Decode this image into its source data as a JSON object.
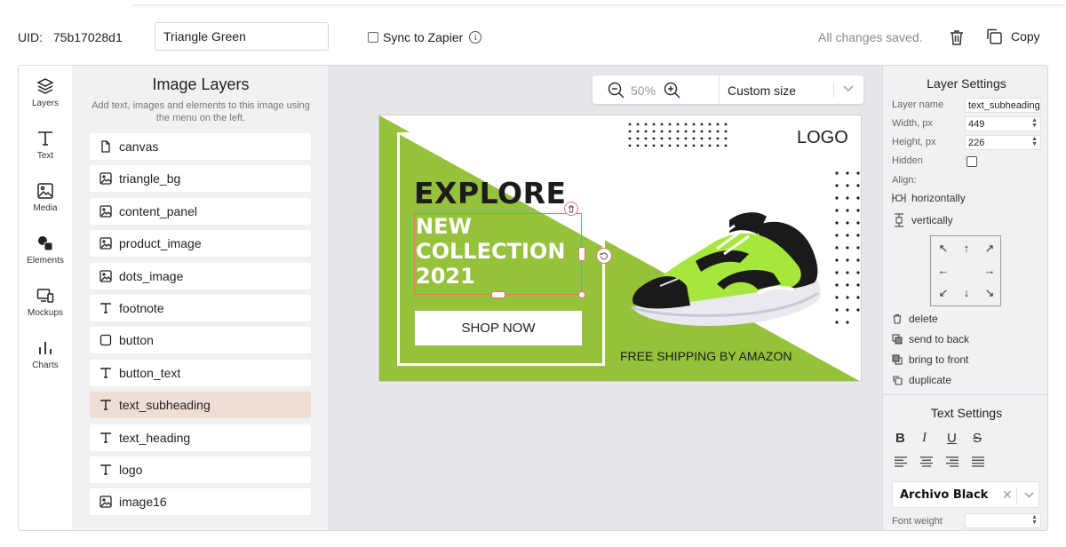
{
  "header": {
    "uid_label": "UID:",
    "uid_value": "75b17028d1",
    "template_name": "Triangle Green",
    "sync_label": "Sync to Zapier",
    "save_status": "All changes saved.",
    "copy_label": "Copy"
  },
  "rail": [
    {
      "label": "Layers",
      "icon": "layers-icon"
    },
    {
      "label": "Text",
      "icon": "text-icon"
    },
    {
      "label": "Media",
      "icon": "image-icon"
    },
    {
      "label": "Elements",
      "icon": "shapes-icon"
    },
    {
      "label": "Mockups",
      "icon": "devices-icon"
    },
    {
      "label": "Charts",
      "icon": "bar-chart-icon"
    }
  ],
  "layers_panel": {
    "title": "Image Layers",
    "subtitle": "Add text, images and elements to this image using the menu on the left.",
    "items": [
      {
        "name": "canvas",
        "icon": "file-icon"
      },
      {
        "name": "triangle_bg",
        "icon": "image-icon"
      },
      {
        "name": "content_panel",
        "icon": "image-icon"
      },
      {
        "name": "product_image",
        "icon": "image-icon"
      },
      {
        "name": "dots_image",
        "icon": "image-icon"
      },
      {
        "name": "footnote",
        "icon": "text-icon"
      },
      {
        "name": "button",
        "icon": "square-icon"
      },
      {
        "name": "button_text",
        "icon": "text-icon"
      },
      {
        "name": "text_subheading",
        "icon": "text-icon",
        "selected": true
      },
      {
        "name": "text_heading",
        "icon": "text-icon"
      },
      {
        "name": "logo",
        "icon": "text-icon"
      },
      {
        "name": "image16",
        "icon": "image-icon"
      }
    ]
  },
  "toolbar": {
    "zoom": "50%",
    "size_option": "Custom size"
  },
  "artboard": {
    "heading": "EXPLORE",
    "subheading_lines": [
      "NEW",
      "COLLECTION",
      "2021"
    ],
    "button_text": "SHOP NOW",
    "logo": "LOGO",
    "footnote": "FREE SHIPPING BY AMAZON",
    "colors": {
      "accent_green": "#95c13b",
      "shoe_green": "#a5e83b",
      "selection": "#e0737a"
    }
  },
  "layer_settings": {
    "title": "Layer Settings",
    "layer_name_label": "Layer name",
    "layer_name_value": "text_subheading",
    "width_label": "Width, px",
    "width_value": "449",
    "height_label": "Height, px",
    "height_value": "226",
    "hidden_label": "Hidden",
    "align_label": "Align:",
    "align_h": "horizontally",
    "align_v": "vertically",
    "actions": [
      "delete",
      "send to back",
      "bring to front",
      "duplicate"
    ]
  },
  "text_settings": {
    "title": "Text Settings",
    "font": "Archivo Black",
    "font_weight_label": "Font weight"
  }
}
